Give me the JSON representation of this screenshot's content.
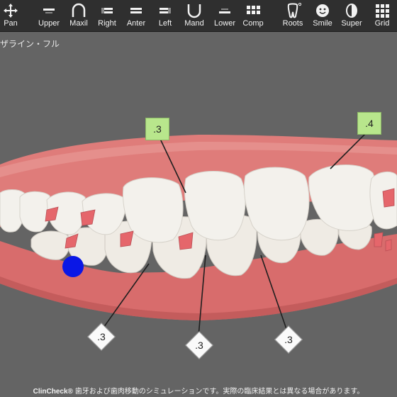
{
  "toolbar": {
    "items": [
      {
        "label": "Pan",
        "icon": "pan-icon"
      },
      {
        "label": "Upper",
        "icon": "upper-icon"
      },
      {
        "label": "Maxil",
        "icon": "maxil-icon"
      },
      {
        "label": "Right",
        "icon": "right-icon"
      },
      {
        "label": "Anter",
        "icon": "anter-icon"
      },
      {
        "label": "Left",
        "icon": "left-icon"
      },
      {
        "label": "Mand",
        "icon": "mand-icon"
      },
      {
        "label": "Lower",
        "icon": "lower-icon"
      },
      {
        "label": "Comp",
        "icon": "comp-icon"
      },
      {
        "label": "Roots",
        "icon": "roots-icon"
      },
      {
        "label": "Smile",
        "icon": "smile-icon"
      },
      {
        "label": "Super",
        "icon": "super-icon"
      },
      {
        "label": "Grid",
        "icon": "grid-icon"
      }
    ]
  },
  "view_label": "ザライン・フル",
  "tags": {
    "upper_left": ".3",
    "upper_right": ".4",
    "lower_left": ".3",
    "lower_mid": ".3",
    "lower_right": ".3"
  },
  "footer": {
    "brand": "ClinCheck®",
    "text": " 歯牙および歯肉移動のシミュレーションです。実際の臨床結果とは異なる場合があります。"
  },
  "colors": {
    "background": "#646464",
    "toolbar": "#2f2f2f",
    "gum": "#e07a78",
    "tooth": "#f1efe9",
    "attachment": "#e56a6e",
    "tag_green": "#b8e68c",
    "marker": "#0a17e6"
  }
}
